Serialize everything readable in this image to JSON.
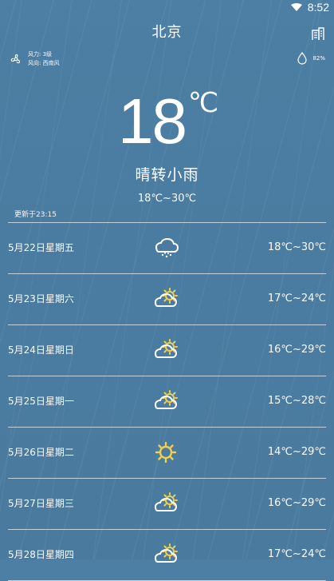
{
  "status": {
    "time": "8:52"
  },
  "header": {
    "city": "北京"
  },
  "current": {
    "wind_power": "风力: 3级",
    "wind_direction": "风向: 西南风",
    "humidity": "82%",
    "temperature": "18",
    "temperature_unit": "℃",
    "condition": "晴转小雨",
    "range": "18℃~30℃",
    "updated": "更新于23:15"
  },
  "forecast": [
    {
      "date": "5月22日星期五",
      "icon": "light-rain-icon",
      "range": "18℃~30℃"
    },
    {
      "date": "5月23日星期六",
      "icon": "partly-sunny-icon",
      "range": "17℃~24℃"
    },
    {
      "date": "5月24日星期日",
      "icon": "partly-sunny-icon",
      "range": "16℃~29℃"
    },
    {
      "date": "5月25日星期一",
      "icon": "partly-sunny-icon",
      "range": "15℃~28℃"
    },
    {
      "date": "5月26日星期二",
      "icon": "sun-icon",
      "range": "14℃~29℃"
    },
    {
      "date": "5月27日星期三",
      "icon": "partly-sunny-icon",
      "range": "16℃~29℃"
    },
    {
      "date": "5月28日星期四",
      "icon": "partly-sunny-icon",
      "range": "17℃~24℃"
    }
  ],
  "colors": {
    "background": "#4a7ba0",
    "sun": "#f2d04b"
  }
}
